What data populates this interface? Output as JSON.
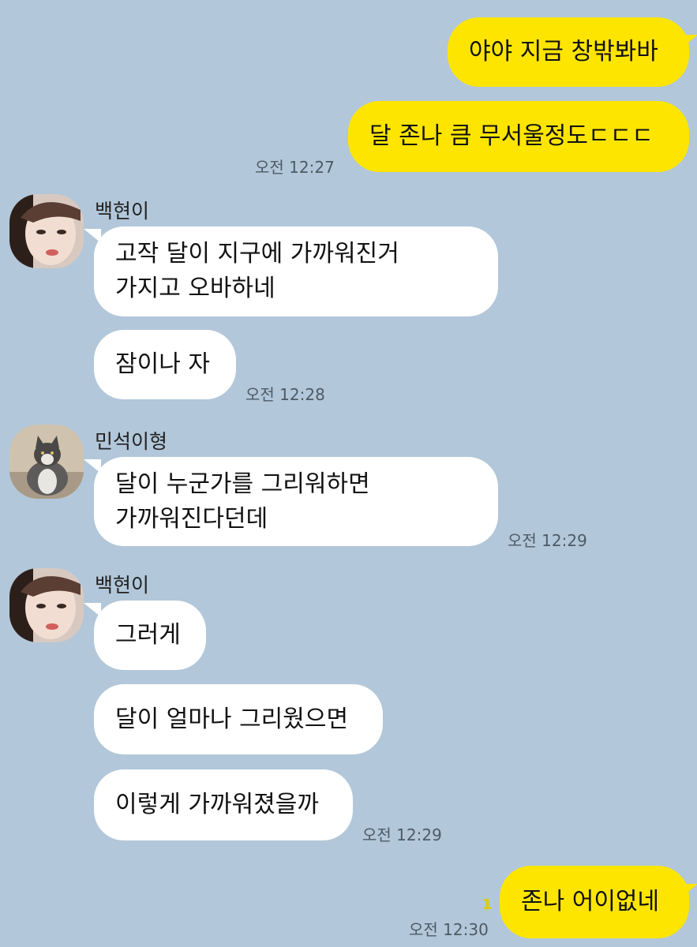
{
  "messages": {
    "m1": "야야 지금 창밖봐바",
    "m2": "달 존나 큼 무서울정도ㄷㄷㄷ",
    "t1": "오전 12:27",
    "s1_name": "백현이",
    "m3_line1": "고작 달이 지구에 가까워진거",
    "m3_line2": "가지고 오바하네",
    "m4": "잠이나 자",
    "t2": "오전 12:28",
    "s2_name": "민석이형",
    "m5_line1": "달이 누군가를 그리워하면",
    "m5_line2": "가까워진다던데",
    "t3": "오전 12:29",
    "s3_name": "백현이",
    "m6": "그러게",
    "m7": "달이 얼마나 그리웠으면",
    "m8": "이렇게 가까워졌을까",
    "t4": "오전 12:29",
    "m9": "존나 어이없네",
    "unread": "1",
    "t5": "오전 12:30"
  },
  "colors": {
    "background": "#b2c7d9",
    "my_bubble": "#fee500",
    "their_bubble": "#ffffff"
  },
  "icons": {
    "avatar_baekhyun": "person-avatar-icon",
    "avatar_minseok": "cat-avatar-icon"
  }
}
